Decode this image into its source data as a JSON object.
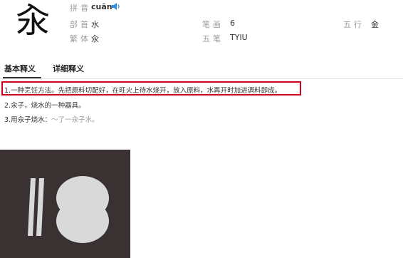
{
  "character": "汆",
  "info": {
    "pinyin_label": "拼音",
    "pinyin_value": "cuān",
    "radical_label": "部首",
    "radical_value": "水",
    "strokes_label": "笔画",
    "strokes_value": "6",
    "wuxing_label": "五行",
    "wuxing_value": "金",
    "traditional_label": "繁体",
    "traditional_value": "汆",
    "wubi_label": "五笔",
    "wubi_value": "TYIU"
  },
  "tabs": [
    {
      "label": "基本释义",
      "active": true
    },
    {
      "label": "详细释义",
      "active": false
    }
  ],
  "definitions": {
    "d1": "1.一种烹饪方法。先把原料切配好，在旺火上待水烧开，放入原料，水再开时加进调料即成。",
    "d2": "2.汆子，烧水的一种器具。",
    "d3_text": "3.用汆子烧水：",
    "d3_example": "～了一汆子水。"
  },
  "colors": {
    "highlight_border": "#d0021b",
    "speaker_icon": "#2a8fe0",
    "photo_bg": "#3e3636",
    "photo_shape": "#d9d9d9"
  },
  "icons": {
    "speaker": "speaker-icon"
  }
}
